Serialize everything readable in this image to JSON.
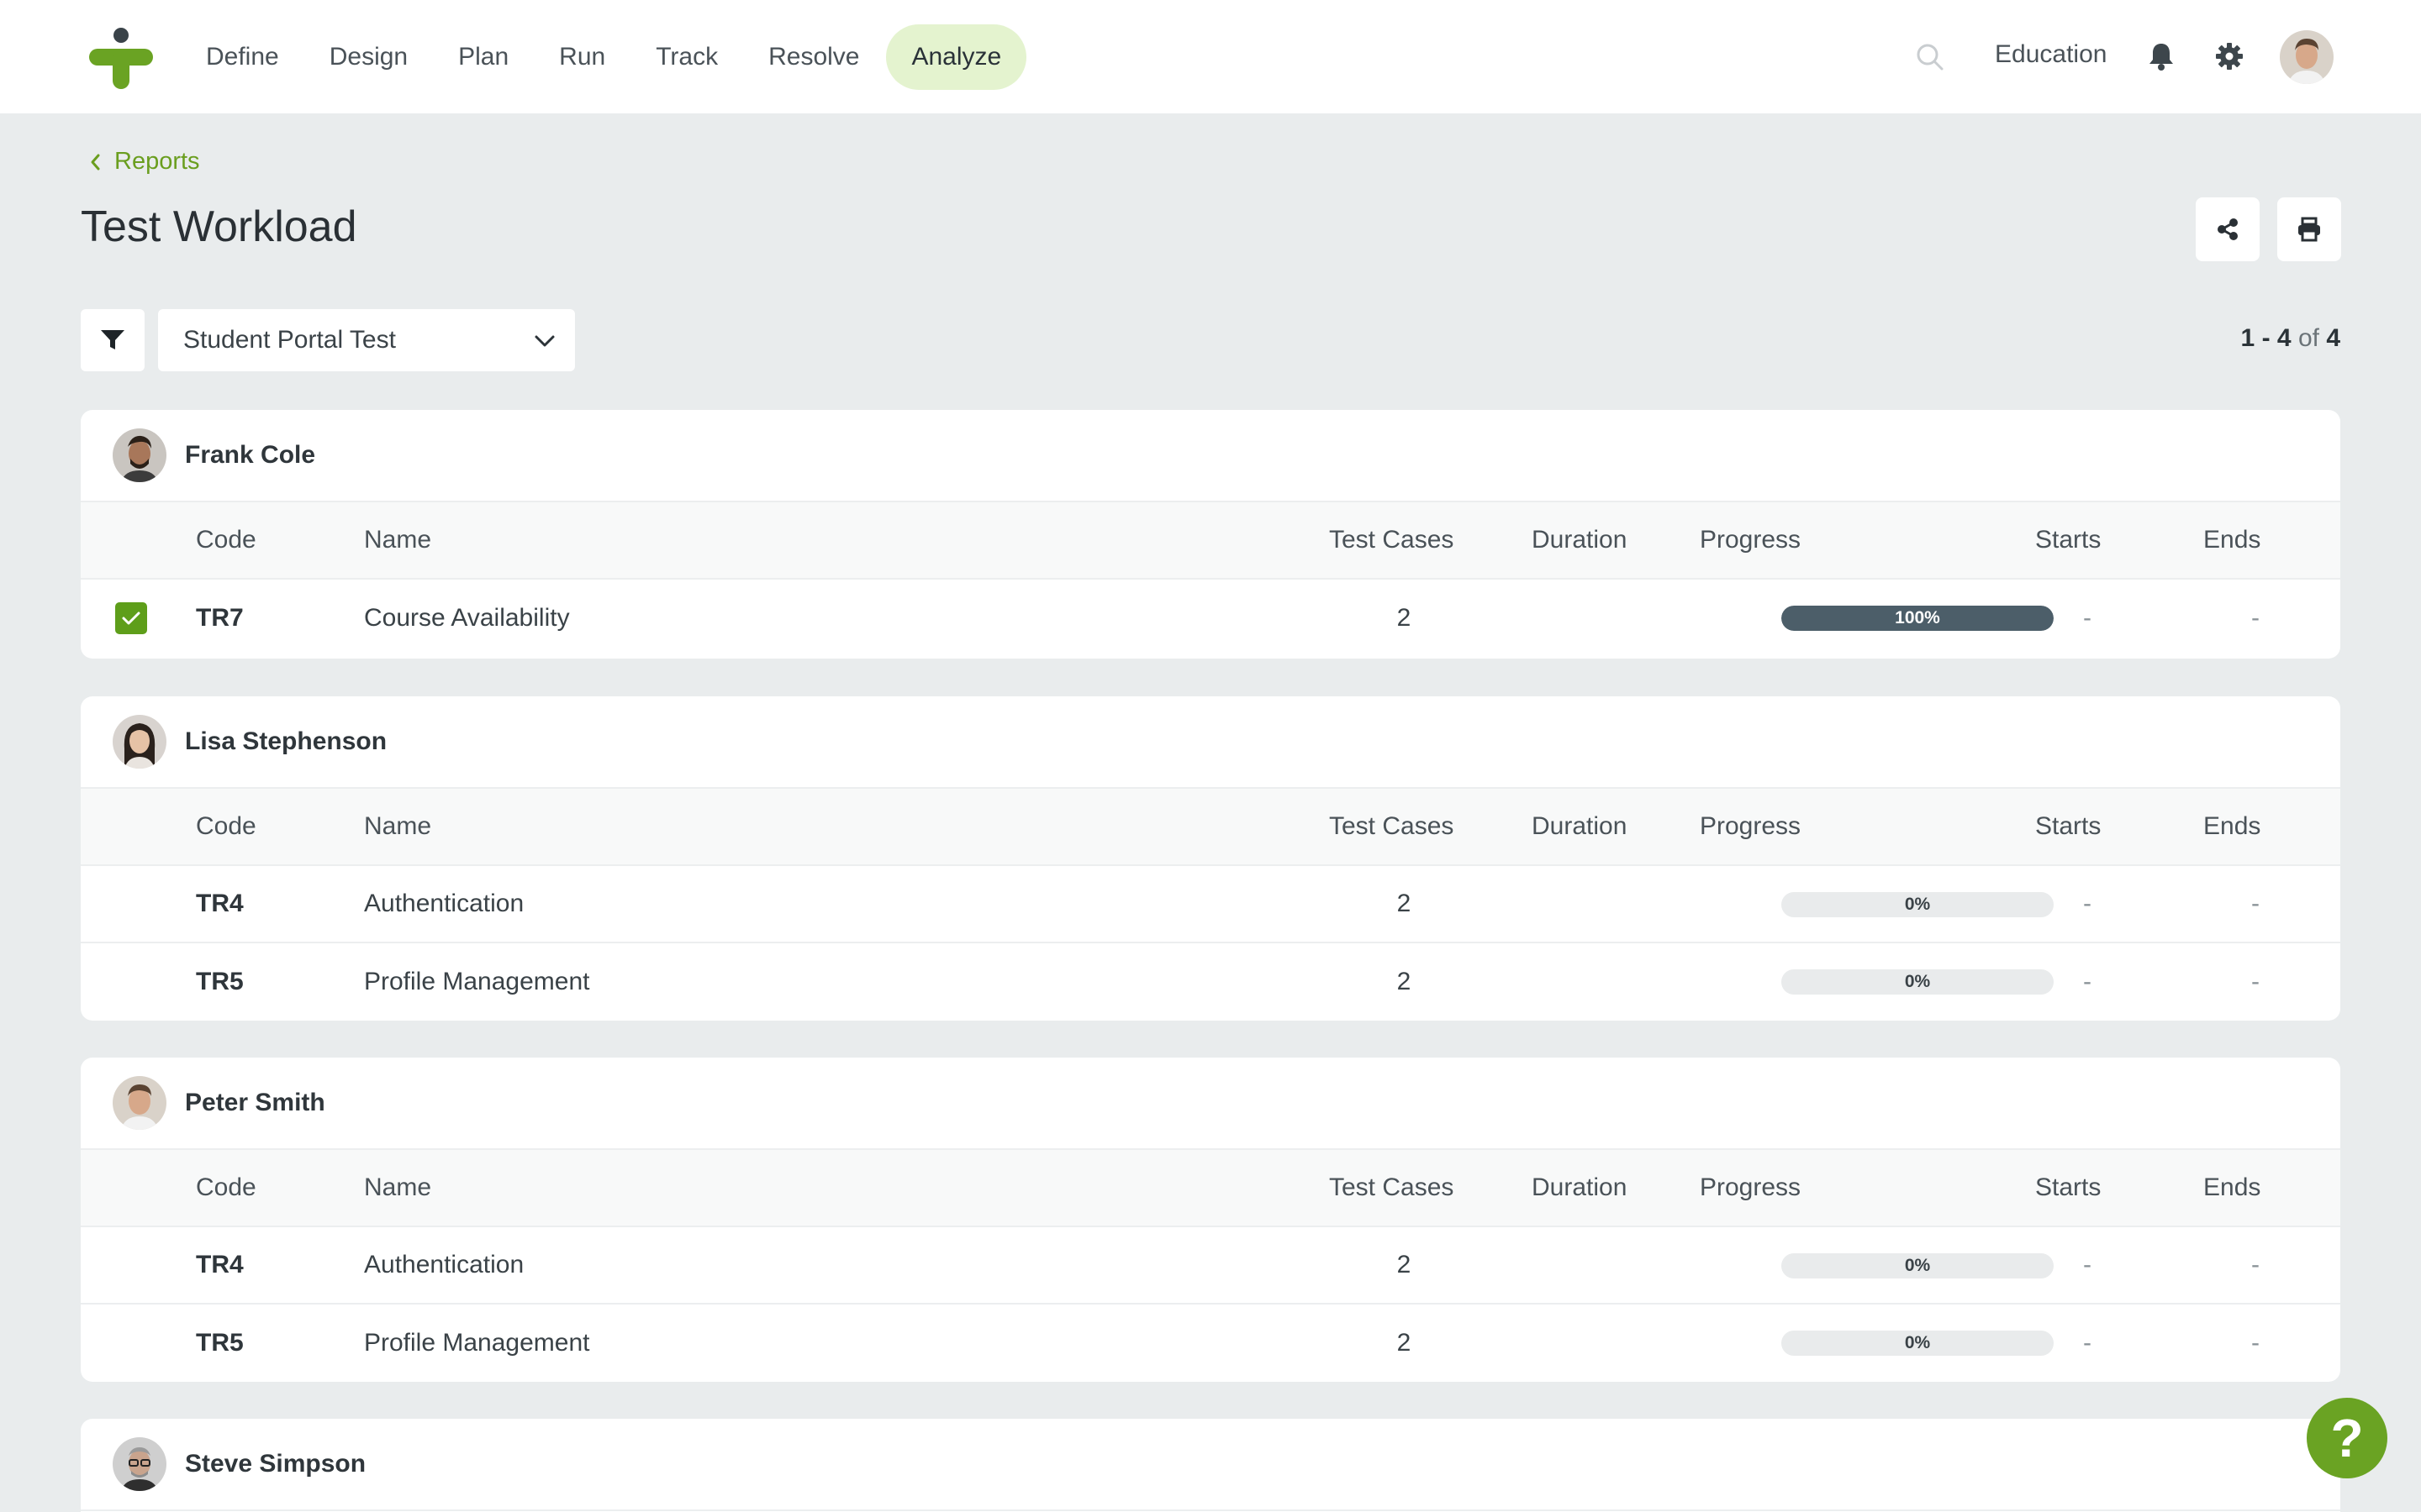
{
  "nav": {
    "items": [
      "Define",
      "Design",
      "Plan",
      "Run",
      "Track",
      "Resolve",
      "Analyze"
    ],
    "active": "Analyze",
    "org_name": "Education"
  },
  "icons": {
    "logo": "plus-logo-icon",
    "search": "search-icon",
    "bell": "bell-icon",
    "gear": "gear-icon",
    "share": "share-icon",
    "print": "printer-icon",
    "filter": "filter-icon",
    "help": "help-icon"
  },
  "colors": {
    "accent": "#6a9e1f",
    "active_nav_bg": "#e4f3cf",
    "progress_fill": "#4c5e69",
    "help_btn": "#6aa323",
    "checkbox": "#5e9e1a"
  },
  "header": {
    "breadcrumb": "Reports",
    "title": "Test Workload"
  },
  "filter": {
    "selected": "Student Portal Test"
  },
  "pager": {
    "start": "1",
    "sep": "-",
    "end": "4",
    "of": "of",
    "total": "4"
  },
  "columns": {
    "code": "Code",
    "name": "Name",
    "test_cases": "Test Cases",
    "duration": "Duration",
    "progress": "Progress",
    "starts": "Starts",
    "ends": "Ends"
  },
  "groups": [
    {
      "assignee": "Frank Cole",
      "rows": [
        {
          "checked": true,
          "code": "TR7",
          "name": "Course Availability",
          "test_cases": "2",
          "duration": "",
          "progress": 100,
          "progress_label": "100%",
          "starts": "-",
          "ends": "-"
        }
      ]
    },
    {
      "assignee": "Lisa Stephenson",
      "rows": [
        {
          "checked": false,
          "code": "TR4",
          "name": "Authentication",
          "test_cases": "2",
          "duration": "",
          "progress": 0,
          "progress_label": "0%",
          "starts": "-",
          "ends": "-"
        },
        {
          "checked": false,
          "code": "TR5",
          "name": "Profile Management",
          "test_cases": "2",
          "duration": "",
          "progress": 0,
          "progress_label": "0%",
          "starts": "-",
          "ends": "-"
        }
      ]
    },
    {
      "assignee": "Peter Smith",
      "rows": [
        {
          "checked": false,
          "code": "TR4",
          "name": "Authentication",
          "test_cases": "2",
          "duration": "",
          "progress": 0,
          "progress_label": "0%",
          "starts": "-",
          "ends": "-"
        },
        {
          "checked": false,
          "code": "TR5",
          "name": "Profile Management",
          "test_cases": "2",
          "duration": "",
          "progress": 0,
          "progress_label": "0%",
          "starts": "-",
          "ends": "-"
        }
      ]
    },
    {
      "assignee": "Steve Simpson",
      "rows": []
    }
  ],
  "help": {
    "glyph": "?"
  }
}
